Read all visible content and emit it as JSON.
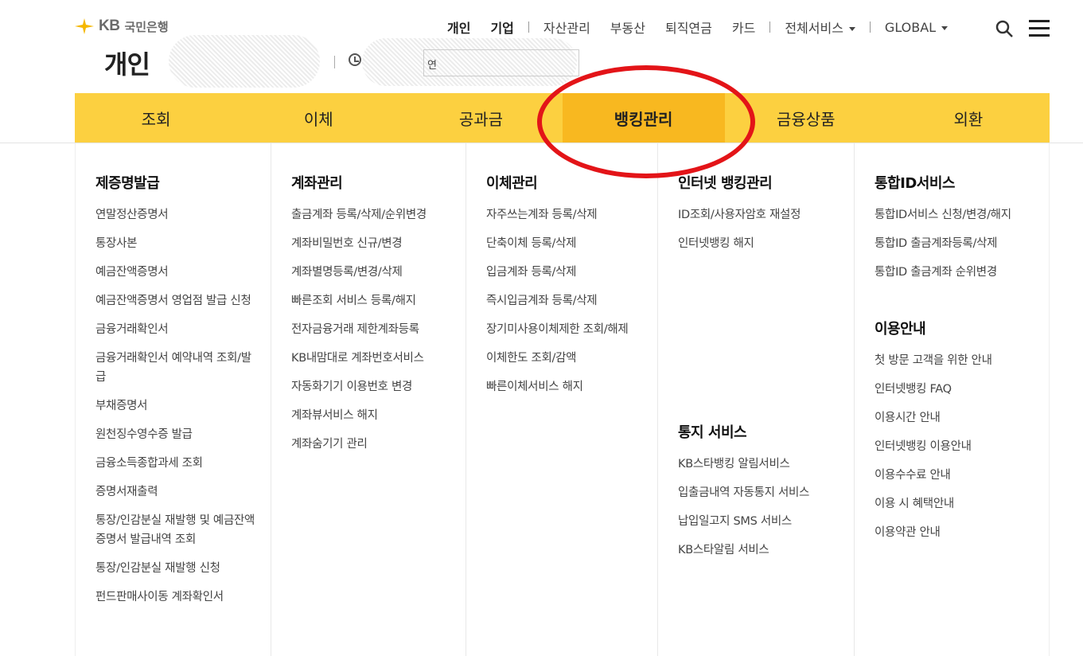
{
  "header": {
    "logo_kb": "KB",
    "logo_bank": "국민은행",
    "page_title": "개인",
    "time_prefix": "연"
  },
  "top_nav": {
    "items": [
      "개인",
      "기업",
      "자산관리",
      "부동산",
      "퇴직연금",
      "카드",
      "전체서비스",
      "GLOBAL"
    ]
  },
  "gnb": {
    "tabs": [
      "조회",
      "이체",
      "공과금",
      "뱅킹관리",
      "금융상품",
      "외환"
    ],
    "active": "뱅킹관리"
  },
  "menu": {
    "col1": {
      "title": "제증명발급",
      "items": [
        "연말정산증명서",
        "통장사본",
        "예금잔액증명서",
        "예금잔액증명서 영업점 발급 신청",
        "금융거래확인서",
        "금융거래확인서 예약내역 조회/발급",
        "부채증명서",
        "원천징수영수증 발급",
        "금융소득종합과세 조회",
        "증명서재출력",
        "통장/인감분실 재발행 및 예금잔액증명서 발급내역 조회",
        "통장/인감분실 재발행 신청",
        "펀드판매사이동 계좌확인서"
      ]
    },
    "col2": {
      "title": "계좌관리",
      "items": [
        "출금계좌 등록/삭제/순위변경",
        "계좌비밀번호 신규/변경",
        "계좌별명등록/변경/삭제",
        "빠른조회 서비스 등록/해지",
        "전자금융거래 제한계좌등록",
        "KB내맘대로 계좌번호서비스",
        "자동화기기 이용번호 변경",
        "계좌뷰서비스 해지",
        "계좌숨기기 관리"
      ]
    },
    "col3": {
      "title": "이체관리",
      "items": [
        "자주쓰는계좌 등록/삭제",
        "단축이체 등록/삭제",
        "입금계좌 등록/삭제",
        "즉시입금계좌 등록/삭제",
        "장기미사용이체제한 조회/해제",
        "이체한도 조회/감액",
        "빠른이체서비스 해지"
      ]
    },
    "col4": {
      "title": "인터넷 뱅킹관리",
      "items": [
        "ID조회/사용자암호 재설정",
        "인터넷뱅킹 해지"
      ],
      "sub_title": "통지 서비스",
      "sub_items": [
        "KB스타뱅킹 알림서비스",
        "입출금내역 자동통지 서비스",
        "납입일고지 SMS 서비스",
        "KB스타알림 서비스"
      ]
    },
    "col5": {
      "title": "통합ID서비스",
      "items": [
        "통합ID서비스 신청/변경/해지",
        "통합ID 출금계좌등록/삭제",
        "통합ID 출금계좌 순위변경"
      ],
      "sub_title": "이용안내",
      "sub_items": [
        "첫 방문 고객을 위한 안내",
        "인터넷뱅킹 FAQ",
        "이용시간 안내",
        "인터넷뱅킹 이용안내",
        "이용수수료 안내",
        "이용 시 혜택안내",
        "이용약관 안내"
      ]
    }
  },
  "colors": {
    "gnb_bg": "#fcd040",
    "gnb_active": "#f8b820",
    "highlight": "#e31418"
  },
  "icons": [
    "kb-star-icon",
    "clock-icon",
    "search-icon",
    "hamburger-menu-icon",
    "caret-down-icon"
  ]
}
